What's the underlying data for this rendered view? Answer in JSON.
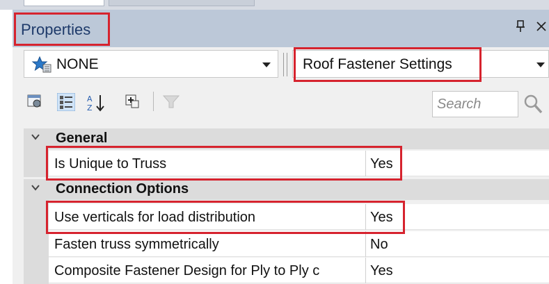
{
  "panel": {
    "title": "Properties"
  },
  "selector": {
    "left_value": "NONE",
    "right_value": "Roof Fastener Settings"
  },
  "toolbar": {
    "search_placeholder": "Search"
  },
  "grid": {
    "categories": [
      {
        "label": "General",
        "rows": [
          {
            "name": "Is Unique to Truss",
            "value": "Yes"
          }
        ]
      },
      {
        "label": "Connection Options",
        "rows": [
          {
            "name": "Use verticals for load distribution",
            "value": "Yes"
          },
          {
            "name": "Fasten truss symmetrically",
            "value": "No"
          },
          {
            "name": "Composite Fastener Design for Ply to Ply c",
            "value": "Yes"
          }
        ]
      }
    ]
  },
  "colors": {
    "highlight": "#d6232e",
    "titlebar": "#bcc8d8",
    "category_bg": "#dcdcdc"
  },
  "icons": [
    "star-icon",
    "pin-icon",
    "close-icon",
    "dropdown-caret-icon",
    "property-pages-icon",
    "categorized-icon",
    "alphabetical-sort-icon",
    "add-icon",
    "filter-icon",
    "search-icon",
    "collapse-chevron-icon"
  ]
}
